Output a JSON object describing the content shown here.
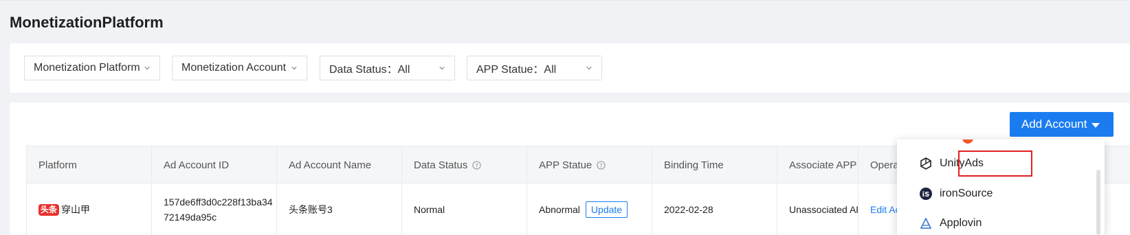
{
  "page": {
    "title": "MonetizationPlatform"
  },
  "filters": [
    {
      "label": "Monetization Platform"
    },
    {
      "label": "Monetization Account"
    },
    {
      "label": "Data Status：All"
    },
    {
      "label": "APP Statue：All"
    }
  ],
  "toolbar": {
    "add_account_label": "Add Account"
  },
  "table": {
    "headers": [
      "Platform",
      "Ad Account ID",
      "Ad Account Name",
      "Data Status",
      "APP Statue",
      "Binding Time",
      "Associate APP",
      "Operation"
    ],
    "rows": [
      {
        "platform_logo": "头条",
        "platform_name": "穿山甲",
        "account_id_line1": "157de6ff3d0c228f13ba34",
        "account_id_line2": "72149da95c",
        "account_name": "头条账号3",
        "data_status": "Normal",
        "app_statue": "Abnormal",
        "update_label": "Update",
        "binding_time": "2022-02-28",
        "associate_app": "Unassociated APP",
        "operation_link": "Edit Account"
      }
    ]
  },
  "dropdown": {
    "items": [
      {
        "label": "UnityAds",
        "icon": "unity-icon",
        "highlighted": true
      },
      {
        "label": "ironSource",
        "icon": "ironsource-icon"
      },
      {
        "label": "Applovin",
        "icon": "applovin-icon"
      }
    ]
  },
  "colors": {
    "accent": "#1a7cf0",
    "highlight_border": "#e02020",
    "toutiao_red": "#e8322e"
  }
}
